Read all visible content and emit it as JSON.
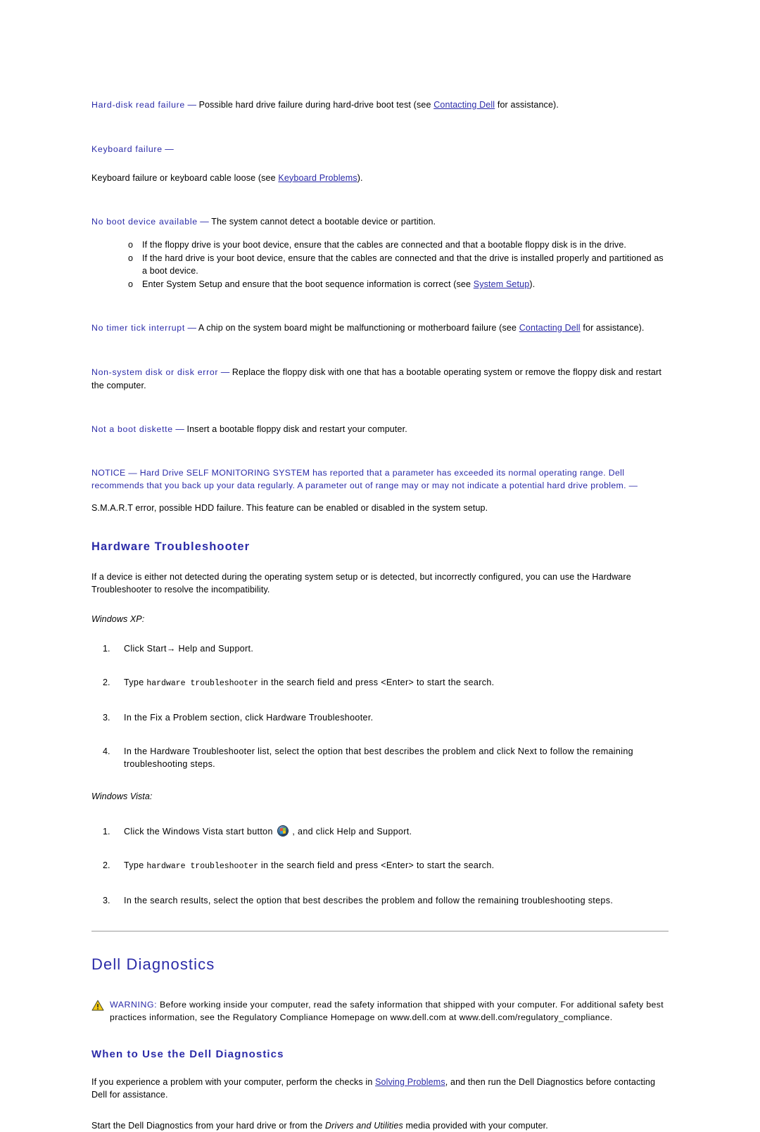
{
  "messages": [
    {
      "label": "Hard-disk read failure",
      "dash": "—",
      "text_before": "Possible hard drive failure during hard-drive boot test (see ",
      "link": "Contacting Dell",
      "text_after": " for assistance)."
    },
    {
      "label": "No boot device available",
      "dash": "—",
      "text_before": "The system cannot detect a bootable device or partition.",
      "bullets": [
        "If the floppy drive is your boot device, ensure that the cables are connected and that a bootable floppy disk is in the drive.",
        "If the hard drive is your boot device, ensure that the cables are connected and that the drive is installed properly and partitioned as a boot device.",
        "Enter System Setup and ensure that the boot sequence information is correct (see ",
        "System Setup",
        ")."
      ]
    },
    {
      "label": "No timer tick interrupt",
      "dash": "—",
      "text_before": "A chip on the system board might be malfunctioning or motherboard failure (see ",
      "link": "Contacting Dell",
      "text_after": " for assistance)."
    },
    {
      "label": "Non-system disk or disk error",
      "dash": "—",
      "text_before": "Replace the floppy disk with one that has a bootable operating system or remove the floppy disk and restart the computer."
    },
    {
      "label": "Not a boot diskette",
      "dash": "—",
      "text_before": "Insert a bootable floppy disk and restart your computer."
    }
  ],
  "keyboard_failure": {
    "label": "Keyboard failure",
    "dash": "—",
    "body_before": "Keyboard failure or keyboard cable loose (see ",
    "link": "Keyboard Problems",
    "body_after": ")."
  },
  "notice": {
    "text": "NOTICE — Hard Drive SELF MONITORING SYSTEM has reported that a parameter has exceeded its normal operating range. Dell recommends that you back up your data regularly. A parameter out of range may or may not indicate a potential hard drive problem. —",
    "body": "S.M.A.R.T error, possible HDD failure. This feature can be enabled or disabled in the system setup."
  },
  "hardware_troubleshooter": {
    "heading": "Hardware Troubleshooter",
    "intro": "If a device is either not detected during the operating system setup or is detected, but incorrectly configured, you can use the Hardware Troubleshooter to resolve the incompatibility.",
    "xp_label": "Windows XP:",
    "xp_steps": [
      {
        "pre": "Click Start",
        "arrow": "→",
        "post": " Help and Support."
      },
      {
        "pre": "Type ",
        "mono": "hardware troubleshooter",
        "post": " in the search field and press <Enter> to start the search."
      },
      {
        "pre": "In the Fix a Problem section, click Hardware Troubleshooter."
      },
      {
        "pre": "In the Hardware Troubleshooter list, select the option that best describes the problem and click Next to follow the remaining troubleshooting steps."
      }
    ],
    "vista_label": "Windows Vista:",
    "vista_steps": [
      {
        "pre": "Click the Windows Vista start button ",
        "orb": "windows-vista-orb-icon",
        "post": " , and click Help and Support."
      },
      {
        "pre": "Type ",
        "mono": "hardware troubleshooter",
        "post": " in the search field and press <Enter> to start the search."
      },
      {
        "pre": "In the search results, select the option that best describes the problem and follow the remaining troubleshooting steps."
      }
    ]
  },
  "dell_diagnostics": {
    "heading": "Dell Diagnostics",
    "warning_word": "WARNING:",
    "warning_text": " Before working inside your computer, read the safety information that shipped with your computer. For additional safety best practices information, see the Regulatory Compliance Homepage on www.dell.com at www.dell.com/regulatory_compliance.",
    "subheading": "When to Use the Dell Diagnostics",
    "para1_before": "If you experience a problem with your computer, perform the checks in ",
    "para1_link": "Solving Problems",
    "para1_after": ", and then run the Dell Diagnostics before contacting Dell for assistance.",
    "para2_before": "Start the Dell Diagnostics from your hard drive or from the ",
    "para2_italic": "Drivers and Utilities",
    "para2_after": " media provided with your computer."
  },
  "colors": {
    "heading_blue": "#2B2BA8",
    "link_blue": "#2B2BA8",
    "body_black": "#000000",
    "divider_gray": "#9a9a9a",
    "warning_yellow": "#F2C811"
  }
}
